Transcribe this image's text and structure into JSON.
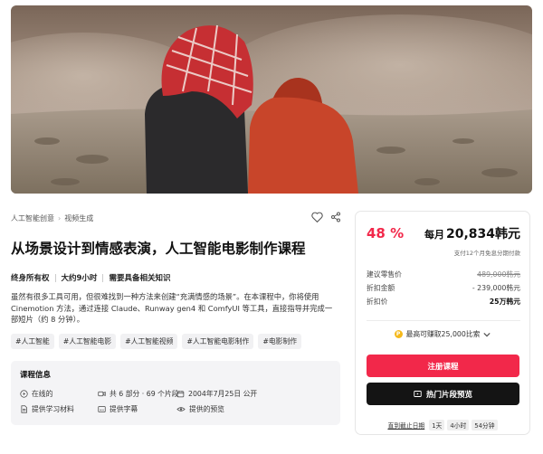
{
  "breadcrumb": {
    "items": [
      "人工智能创意",
      "视频生成"
    ]
  },
  "title": "从场景设计到情感表演，人工智能电影制作课程",
  "meta": [
    "终身所有权",
    "大约9小时",
    "需要具备相关知识"
  ],
  "description": "虽然有很多工具可用，但很难找到一种方法来创建“充满情感的场景”。在本课程中，你将使用 Cinemotion 方法，通过连接 Claude、Runway gen4 和 ComfyUI 等工具，直接指导并完成一部短片（约 8 分钟）。",
  "tags": [
    "#人工智能",
    "#人工智能电影",
    "#人工智能视频",
    "#人工智能电影制作",
    "#电影制作"
  ],
  "course_info": {
    "heading": "课程信息",
    "items": [
      {
        "icon": "play-circle-icon",
        "text": "在线的"
      },
      {
        "icon": "video-icon",
        "text": "共 6 部分 · 69 个片段"
      },
      {
        "icon": "calendar-icon",
        "text": "2004年7月25日 公开"
      },
      {
        "icon": "document-icon",
        "text": "提供学习材料"
      },
      {
        "icon": "subtitle-icon",
        "text": "提供字幕"
      },
      {
        "icon": "eye-icon",
        "text": "提供的预览"
      }
    ]
  },
  "pricing": {
    "discount": "48 %",
    "monthly_label": "每月",
    "monthly_price": "20,834韩元",
    "installment_note": "支付12个月免息分期付款",
    "rows": [
      {
        "label": "建议零售价",
        "value": "489,000韩元"
      },
      {
        "label": "折扣金额",
        "value": "- 239,000韩元"
      },
      {
        "label": "折扣价",
        "value": "25万韩元"
      }
    ],
    "points": "最高可赚取25,000比索",
    "points_coin": "P",
    "register_button": "注册课程",
    "preview_button": "热门片段预览",
    "countdown_label": "直到截止日期",
    "countdown": [
      "1天",
      "4小时",
      "54分钟"
    ]
  },
  "colors": {
    "accent": "#f2284a",
    "dark_button": "#141414",
    "coin": "#f5b91b"
  }
}
